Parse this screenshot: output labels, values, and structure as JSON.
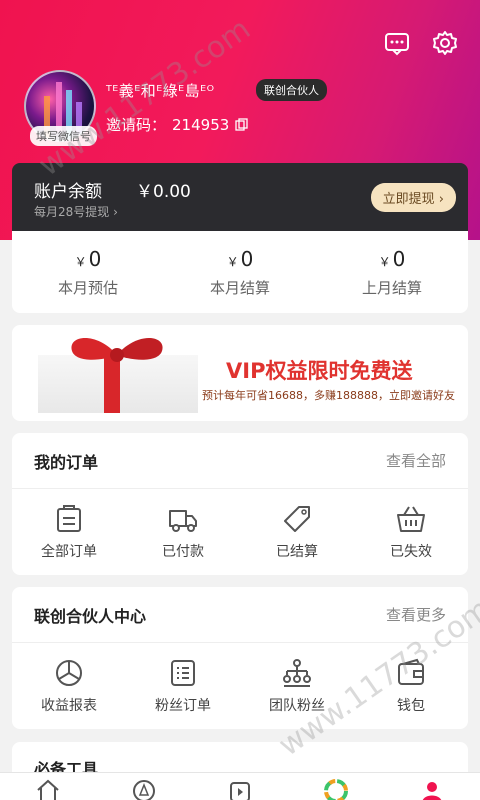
{
  "header": {
    "nickname": "ᵀᴱ義ᴱ和ᴱ綠ᴱ島ᴱᴼ",
    "partner_badge": "联创合伙人",
    "wechat_badge": "填写微信号",
    "invite_label": "邀请码：",
    "invite_code": "214953"
  },
  "balance": {
    "label": "账户余额",
    "amount": "￥0.00",
    "sub": "每月28号提现 ›",
    "withdraw": "立即提现 ›"
  },
  "stats": [
    {
      "currency": "￥",
      "value": "0",
      "label": "本月预估"
    },
    {
      "currency": "￥",
      "value": "0",
      "label": "本月结算"
    },
    {
      "currency": "￥",
      "value": "0",
      "label": "上月结算"
    }
  ],
  "vip": {
    "title": "VIP权益限时免费送",
    "desc": "预计每年可省16688，多赚188888，立即邀请好友"
  },
  "orders": {
    "title": "我的订单",
    "more": "查看全部",
    "items": [
      "全部订单",
      "已付款",
      "已结算",
      "已失效"
    ]
  },
  "partner": {
    "title": "联创合伙人中心",
    "more": "查看更多",
    "items": [
      "收益报表",
      "粉丝订单",
      "团队粉丝",
      "钱包"
    ]
  },
  "tools": {
    "title": "必备工具"
  },
  "watermark": "www.11773.com",
  "colors": {
    "accent": "#f0134f",
    "card_dark": "#2b2b2f",
    "gold": "#f6e3c0"
  }
}
